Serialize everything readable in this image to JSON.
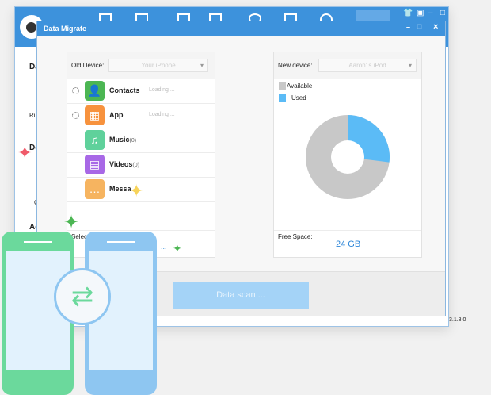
{
  "background_window": {
    "labels": [
      "Da",
      "Ri",
      "De",
      "C",
      "Ad"
    ],
    "window_controls": [
      "shirt-icon",
      "menu-icon",
      "minimize",
      "maximize",
      "close"
    ],
    "version": "3.1.8.0"
  },
  "dialog": {
    "title": "Data Migrate",
    "controls": {
      "minimize": "–",
      "maximize": "□",
      "close": "×"
    }
  },
  "old_device": {
    "label": "Old Device:",
    "value": "Your iPhone",
    "items": [
      {
        "name": "Contacts",
        "count": "",
        "status": "Loading ...",
        "color": "#4cb653",
        "glyph": "👤"
      },
      {
        "name": "App",
        "count": "",
        "status": "Loading ...",
        "color": "#f7923d",
        "glyph": "▦"
      },
      {
        "name": "Music",
        "count": "(0)",
        "status": "",
        "color": "#5fd19b",
        "glyph": "♫"
      },
      {
        "name": "Videos",
        "count": "(0)",
        "status": "",
        "color": "#a868e6",
        "glyph": "▤"
      },
      {
        "name": "Messa",
        "count": "",
        "status": "",
        "color": "#f6b460",
        "glyph": "…"
      }
    ],
    "selected_label": "Selected:",
    "selected_value": "..."
  },
  "new_device": {
    "label": "New device:",
    "value": "Aaron' s iPod",
    "legend": [
      {
        "label": "Available",
        "color": "#c8c8c8"
      },
      {
        "label": "Used",
        "color": "#5bbbf6"
      }
    ],
    "used_fraction": 0.27,
    "free_label": "Free Space:",
    "free_value": "24 GB"
  },
  "scan_button": "Data scan ..."
}
